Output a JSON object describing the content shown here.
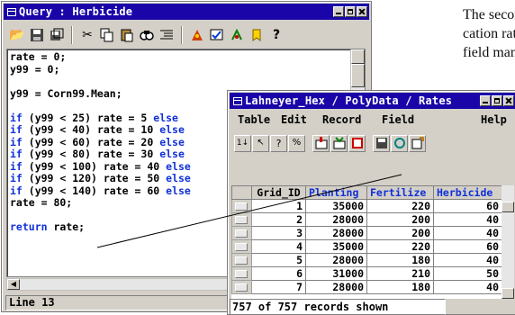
{
  "background_text": [
    "The second",
    "cation rate",
    "field manag"
  ],
  "query_window": {
    "title": "Query : Herbicide",
    "code": [
      {
        "kind": "text",
        "text": "rate = 0;"
      },
      {
        "kind": "text",
        "text": "y99 = 0;"
      },
      {
        "kind": "text",
        "text": ""
      },
      {
        "kind": "text",
        "text": "y99 = Corn99.Mean;"
      },
      {
        "kind": "text",
        "text": ""
      },
      {
        "kind": "cond",
        "kw1": "if",
        "cond": " (y99 < 25) rate = 5 ",
        "kw2": "else"
      },
      {
        "kind": "cond",
        "kw1": "if",
        "cond": " (y99 < 40) rate = 10 ",
        "kw2": "else"
      },
      {
        "kind": "cond",
        "kw1": "if",
        "cond": " (y99 < 60) rate = 20 ",
        "kw2": "else"
      },
      {
        "kind": "cond",
        "kw1": "if",
        "cond": " (y99 < 80) rate = 30 ",
        "kw2": "else"
      },
      {
        "kind": "cond",
        "kw1": "if",
        "cond": " (y99 < 100) rate = 40 ",
        "kw2": "else"
      },
      {
        "kind": "cond",
        "kw1": "if",
        "cond": " (y99 < 120) rate = 50 ",
        "kw2": "else"
      },
      {
        "kind": "cond",
        "kw1": "if",
        "cond": " (y99 < 140) rate = 60 ",
        "kw2": "else"
      },
      {
        "kind": "text",
        "text": "rate = 80;"
      },
      {
        "kind": "text",
        "text": ""
      },
      {
        "kind": "ret",
        "kw1": "return",
        "cond": " rate;"
      }
    ],
    "status": "Line 13"
  },
  "table_window": {
    "title": "Lahneyer_Hex / PolyData / Rates",
    "menu": [
      "Table",
      "Edit",
      "Record",
      "Field",
      "Help"
    ],
    "columns": [
      "Grid_ID",
      "Planting",
      "Fertilize",
      "Herbicide"
    ],
    "rows": [
      [
        "1",
        "35000",
        "220",
        "60"
      ],
      [
        "2",
        "28000",
        "200",
        "40"
      ],
      [
        "3",
        "28000",
        "200",
        "40"
      ],
      [
        "4",
        "35000",
        "220",
        "60"
      ],
      [
        "5",
        "28000",
        "180",
        "40"
      ],
      [
        "6",
        "31000",
        "210",
        "50"
      ],
      [
        "7",
        "28000",
        "180",
        "40"
      ]
    ],
    "status": "757 of 757 records shown"
  },
  "icons": {
    "query_toolbar": [
      "open-folder-icon",
      "save-icon",
      "save-as-icon",
      "cut-icon",
      "copy-icon",
      "paste-icon",
      "find-icon",
      "indent-icon",
      "run-icon",
      "check-icon",
      "insert-icon",
      "stop-icon",
      "help-icon"
    ],
    "table_toolbar": [
      "sort-icon",
      "select-icon",
      "query-icon",
      "percent-icon",
      "add-field-icon",
      "join-icon",
      "graph-icon",
      "save-icon",
      "relate-icon",
      "export-icon"
    ]
  },
  "colors": {
    "title_bar": "#1a06a8",
    "keyword": "#1030d8",
    "window_bg": "#d4d0c8"
  }
}
